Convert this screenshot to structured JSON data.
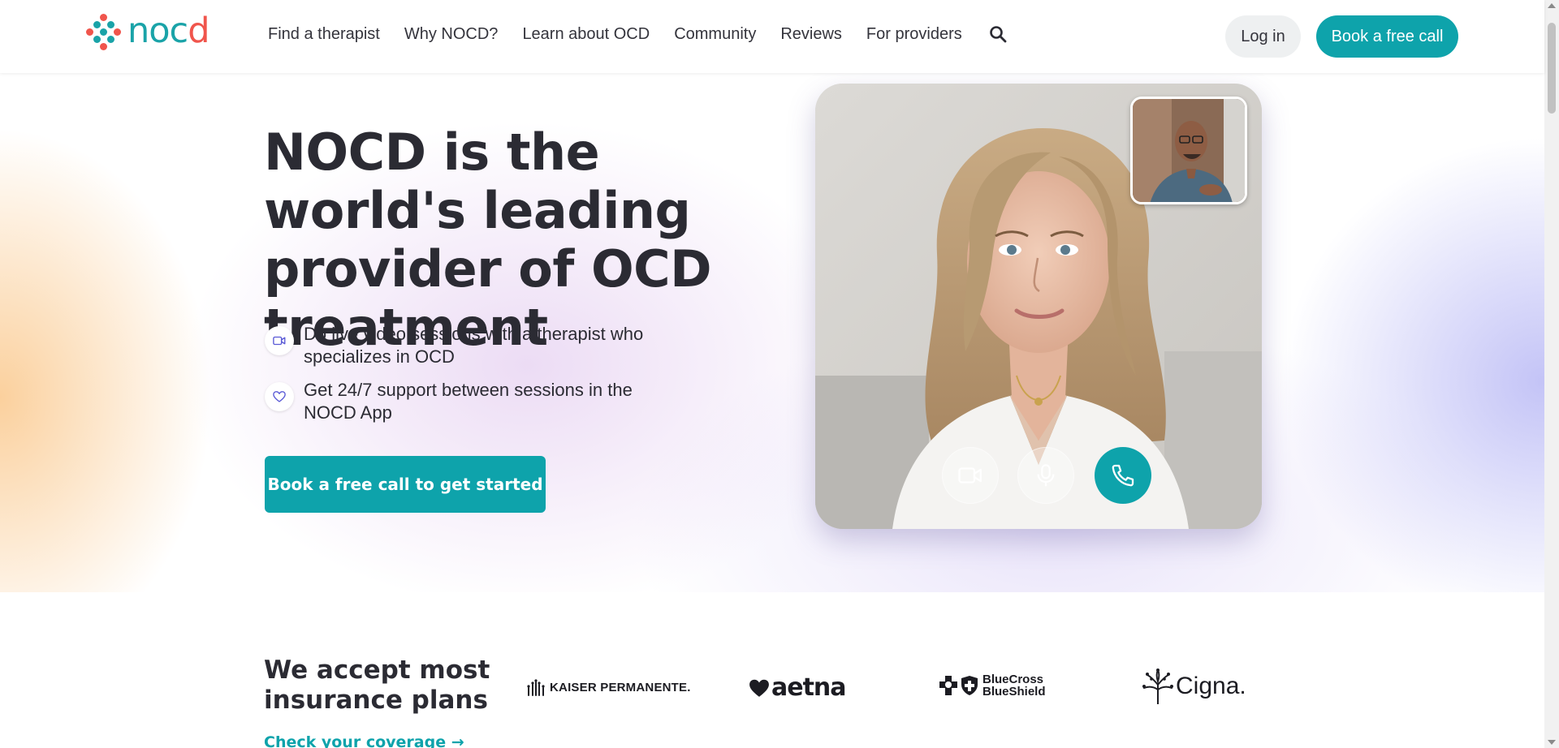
{
  "header": {
    "logo_text": "nocd",
    "nav": [
      "Find a therapist",
      "Why NOCD?",
      "Learn about OCD",
      "Community",
      "Reviews",
      "For providers"
    ],
    "login_label": "Log in",
    "cta_label": "Book a free call"
  },
  "hero": {
    "title": "NOCD is the world's leading provider of OCD treatment",
    "features": [
      {
        "icon": "video-camera-icon",
        "text": "Do live video sessions with a therapist who specializes in OCD"
      },
      {
        "icon": "heart-icon",
        "text": "Get 24/7 support between sessions in the NOCD App"
      }
    ],
    "cta_label": "Book a free call to get started",
    "video_controls": [
      "video-camera-icon",
      "microphone-icon",
      "phone-icon"
    ]
  },
  "insurance": {
    "title": "We accept most insurance plans",
    "link_label": "Check your coverage →",
    "logos": [
      "KAISER PERMANENTE.",
      "aetna",
      "BlueCross BlueShield",
      "Cigna."
    ]
  },
  "colors": {
    "brand_teal": "#0ea3ab",
    "brand_coral": "#f0554c",
    "text_dark": "#2b2b33",
    "button_light": "#eef0f1"
  }
}
